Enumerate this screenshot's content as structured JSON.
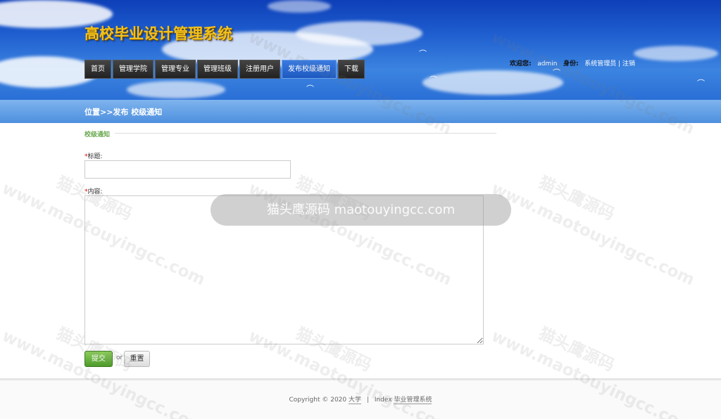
{
  "header": {
    "title": "高校毕业设计管理系统",
    "nav": [
      {
        "label": "首页",
        "active": false
      },
      {
        "label": "管理学院",
        "active": false
      },
      {
        "label": "管理专业",
        "active": false
      },
      {
        "label": "管理班级",
        "active": false
      },
      {
        "label": "注册用户",
        "active": false
      },
      {
        "label": "发布校级通知",
        "active": true
      },
      {
        "label": "下载",
        "active": false
      }
    ],
    "user": {
      "welcome_label": "欢迎您:",
      "username": "admin",
      "role_label": "身份:",
      "role": "系统管理员",
      "separator": "|",
      "logout": "注销"
    }
  },
  "location": {
    "text": "位置>>发布 校级通知"
  },
  "form": {
    "section_title": "校级通知",
    "title_label": "标题:",
    "title_value": "",
    "content_label": "内容:",
    "content_value": "",
    "required_mark": "*",
    "submit": "提交",
    "or": "or",
    "reset": "重置"
  },
  "footer": {
    "copyright": "Copyright © 2020",
    "link1": "大学",
    "sep": "|",
    "link2": "Index",
    "link3": "毕业管理系统"
  },
  "watermark": {
    "cn": "猫头鹰源码",
    "url": "www.maotouyingcc.com",
    "banner": "猫头鹰源码 maotouyingcc.com"
  },
  "colors": {
    "header_blue": "#1f5fd0",
    "title_gold": "#f2c21b",
    "nav_active": "#2a6ad0",
    "section_green": "#6aa84f",
    "submit_green": "#4e9a2b"
  }
}
